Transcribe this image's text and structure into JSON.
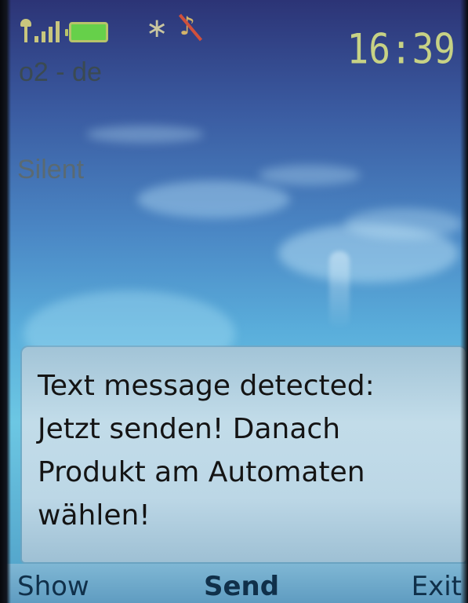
{
  "status_bar": {
    "signal_icon": "signal-strength-icon",
    "battery_icon": "battery-icon",
    "bluetooth_icon": "bluetooth-icon",
    "bluetooth_glyph": "∗",
    "silent_icon": "muted-note-icon",
    "silent_glyph": "♪",
    "time": "16:39"
  },
  "home": {
    "operator": "o2 - de",
    "profile": "Silent"
  },
  "dialog": {
    "message": "Text message detected:\nJetzt senden! Danach\nProdukt am Automaten\nwählen!"
  },
  "softkeys": {
    "left": "Show",
    "center": "Send",
    "right": "Exit"
  },
  "colors": {
    "status_icons": "#c8c67e",
    "battery_fill": "#66d04a",
    "dialog_bg": "#bcd7e6",
    "softkey_text": "#10304a"
  }
}
